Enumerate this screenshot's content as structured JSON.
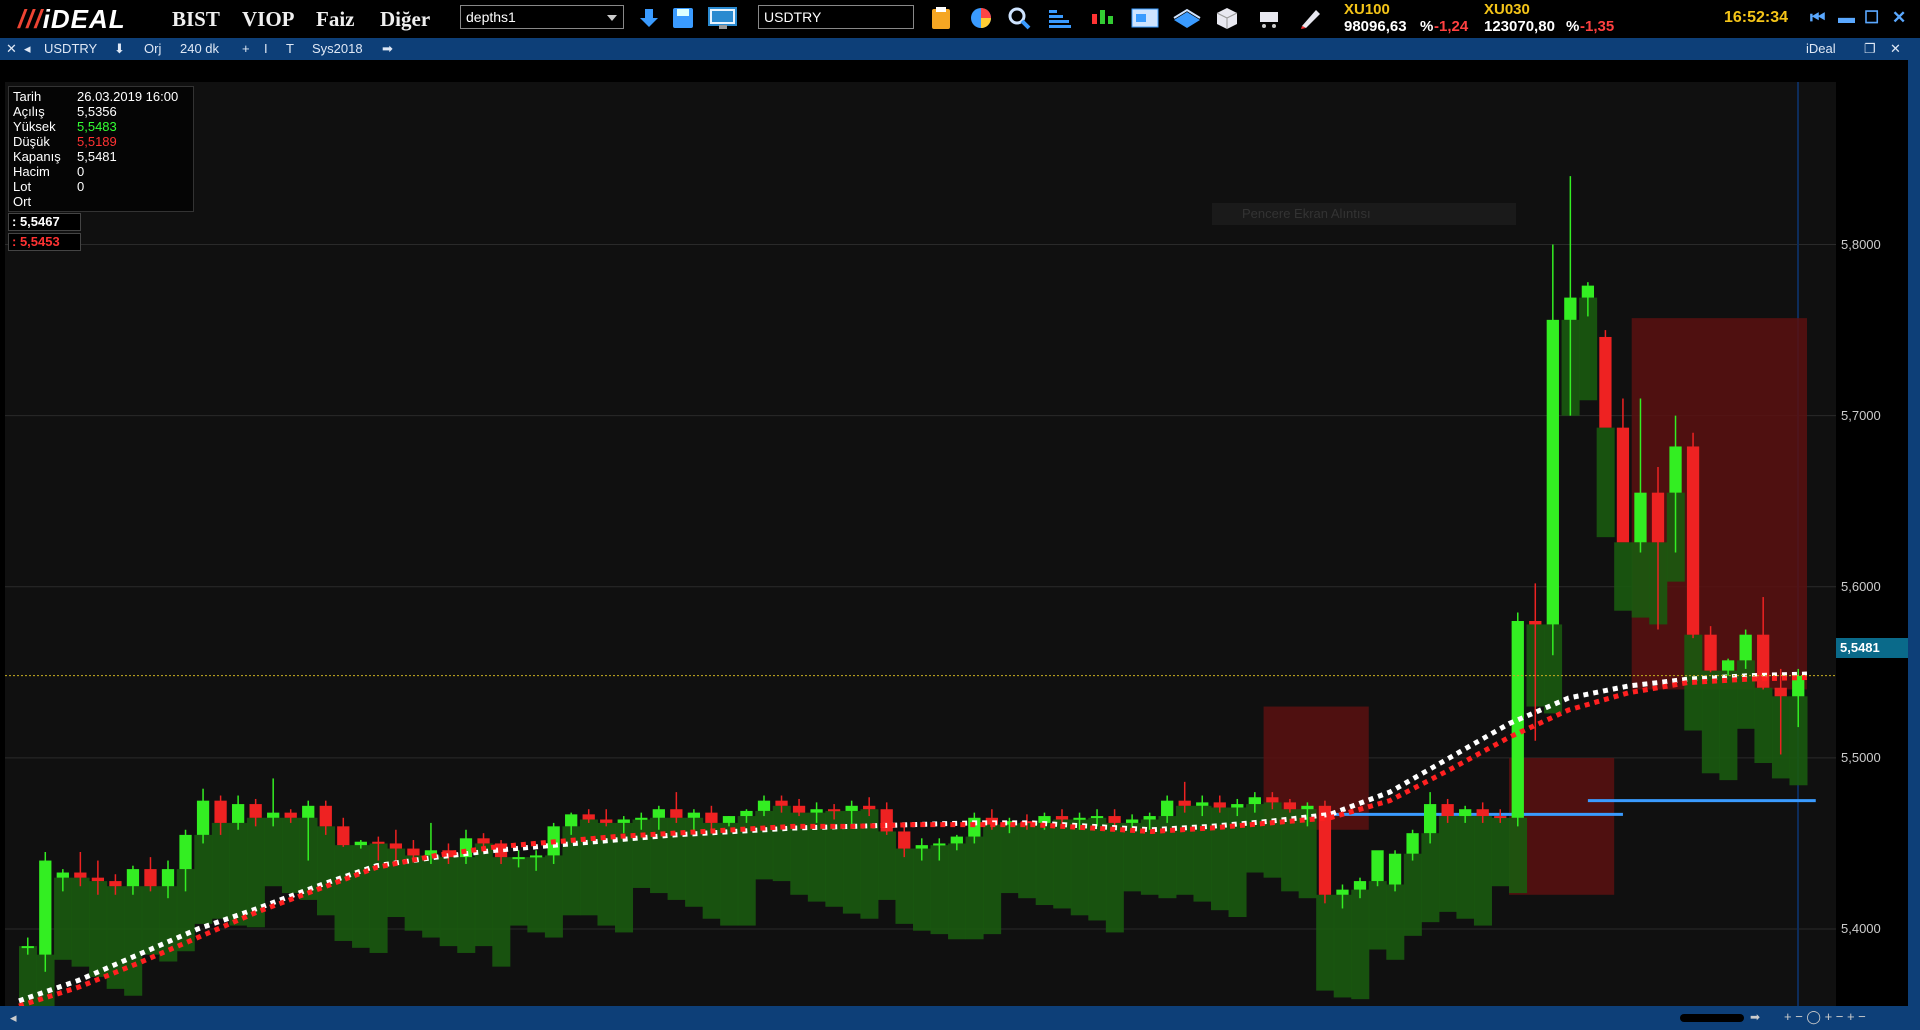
{
  "app": {
    "logo": "iDEAL",
    "menus": [
      "BIST",
      "VIOP",
      "Faiz",
      "Diğer"
    ]
  },
  "toolbar": {
    "layout_select": "depths1",
    "symbol_input": "USDTRY"
  },
  "indices": [
    {
      "name": "XU100",
      "value": "98096,63",
      "pct_label": "%",
      "change": "-1,24"
    },
    {
      "name": "XU030",
      "value": "123070,80",
      "pct_label": "%",
      "change": "-1,35"
    }
  ],
  "clock": "16:52:34",
  "chart_toolbar": {
    "symbol": "USDTRY",
    "orj": "Orj",
    "period": "240 dk",
    "system": "Sys2018",
    "brand": "iDeal"
  },
  "info_panel": {
    "rows": [
      {
        "label": "Tarih",
        "value": "26.03.2019 16:00",
        "color": "#ffffff"
      },
      {
        "label": "Açılış",
        "value": "5,5356",
        "color": "#ffffff"
      },
      {
        "label": "Yüksek",
        "value": "5,5483",
        "color": "#33ff33"
      },
      {
        "label": "Düşük",
        "value": "5,5189",
        "color": "#ff3333"
      },
      {
        "label": "Kapanış",
        "value": "5,5481",
        "color": "#ffffff"
      },
      {
        "label": "Hacim",
        "value": "0",
        "color": "#ffffff"
      },
      {
        "label": "Lot",
        "value": "0",
        "color": "#ffffff"
      },
      {
        "label": "Ort",
        "value": "",
        "color": "#ffffff"
      }
    ],
    "price_white": ": 5,5467",
    "price_red": ": 5,5453"
  },
  "ghost_tooltip": "Pencere Ekran Alıntısı",
  "colors": {
    "up": "#33ee22",
    "down": "#ee2222",
    "shadow_green": "#1a5a10",
    "shadow_red": "#5a1010",
    "accent": "#0d3f78"
  },
  "chart_data": {
    "type": "candlestick",
    "ylim": [
      5.355,
      5.895
    ],
    "ticks": [
      "5,8000",
      "5,7000",
      "5,6000",
      "5,5000",
      "5,4000"
    ],
    "tick_values": [
      5.8,
      5.7,
      5.6,
      5.5,
      5.4
    ],
    "last_price": "5,5481",
    "last_value": 5.5481,
    "candles": [
      [
        5.39,
        5.395,
        5.385,
        5.39
      ],
      [
        5.385,
        5.445,
        5.375,
        5.44
      ],
      [
        5.43,
        5.435,
        5.422,
        5.433
      ],
      [
        5.433,
        5.445,
        5.425,
        5.43
      ],
      [
        5.43,
        5.44,
        5.42,
        5.428
      ],
      [
        5.428,
        5.432,
        5.42,
        5.425
      ],
      [
        5.425,
        5.437,
        5.42,
        5.435
      ],
      [
        5.435,
        5.442,
        5.422,
        5.425
      ],
      [
        5.425,
        5.44,
        5.418,
        5.435
      ],
      [
        5.435,
        5.458,
        5.422,
        5.455
      ],
      [
        5.455,
        5.482,
        5.45,
        5.475
      ],
      [
        5.475,
        5.478,
        5.455,
        5.462
      ],
      [
        5.462,
        5.478,
        5.458,
        5.473
      ],
      [
        5.473,
        5.476,
        5.46,
        5.465
      ],
      [
        5.465,
        5.488,
        5.46,
        5.468
      ],
      [
        5.468,
        5.47,
        5.462,
        5.465
      ],
      [
        5.465,
        5.475,
        5.44,
        5.472
      ],
      [
        5.472,
        5.475,
        5.455,
        5.46
      ],
      [
        5.46,
        5.465,
        5.448,
        5.449
      ],
      [
        5.449,
        5.452,
        5.447,
        5.451
      ],
      [
        5.451,
        5.454,
        5.44,
        5.45
      ],
      [
        5.45,
        5.458,
        5.44,
        5.447
      ],
      [
        5.447,
        5.452,
        5.44,
        5.443
      ],
      [
        5.443,
        5.462,
        5.438,
        5.446
      ],
      [
        5.446,
        5.45,
        5.438,
        5.442
      ],
      [
        5.442,
        5.458,
        5.438,
        5.453
      ],
      [
        5.453,
        5.456,
        5.445,
        5.45
      ],
      [
        5.45,
        5.452,
        5.438,
        5.442
      ],
      [
        5.442,
        5.446,
        5.436,
        5.442
      ],
      [
        5.442,
        5.446,
        5.434,
        5.443
      ],
      [
        5.443,
        5.462,
        5.438,
        5.46
      ],
      [
        5.46,
        5.468,
        5.455,
        5.467
      ],
      [
        5.467,
        5.47,
        5.462,
        5.464
      ],
      [
        5.464,
        5.47,
        5.46,
        5.462
      ],
      [
        5.462,
        5.466,
        5.456,
        5.464
      ],
      [
        5.464,
        5.468,
        5.458,
        5.465
      ],
      [
        5.465,
        5.472,
        5.458,
        5.47
      ],
      [
        5.47,
        5.48,
        5.462,
        5.465
      ],
      [
        5.465,
        5.47,
        5.455,
        5.468
      ],
      [
        5.468,
        5.472,
        5.458,
        5.462
      ],
      [
        5.462,
        5.466,
        5.46,
        5.466
      ],
      [
        5.466,
        5.47,
        5.462,
        5.469
      ],
      [
        5.469,
        5.478,
        5.466,
        5.475
      ],
      [
        5.475,
        5.478,
        5.468,
        5.472
      ],
      [
        5.472,
        5.476,
        5.466,
        5.468
      ],
      [
        5.468,
        5.474,
        5.462,
        5.47
      ],
      [
        5.47,
        5.473,
        5.464,
        5.469
      ],
      [
        5.469,
        5.475,
        5.46,
        5.472
      ],
      [
        5.472,
        5.477,
        5.466,
        5.47
      ],
      [
        5.47,
        5.474,
        5.455,
        5.457
      ],
      [
        5.457,
        5.46,
        5.442,
        5.447
      ],
      [
        5.447,
        5.453,
        5.44,
        5.449
      ],
      [
        5.449,
        5.453,
        5.44,
        5.45
      ],
      [
        5.45,
        5.455,
        5.446,
        5.454
      ],
      [
        5.454,
        5.468,
        5.45,
        5.465
      ],
      [
        5.465,
        5.47,
        5.458,
        5.461
      ],
      [
        5.461,
        5.465,
        5.456,
        5.463
      ],
      [
        5.463,
        5.467,
        5.458,
        5.462
      ],
      [
        5.462,
        5.468,
        5.458,
        5.466
      ],
      [
        5.466,
        5.47,
        5.46,
        5.464
      ],
      [
        5.464,
        5.468,
        5.458,
        5.465
      ],
      [
        5.465,
        5.47,
        5.46,
        5.466
      ],
      [
        5.466,
        5.47,
        5.46,
        5.462
      ],
      [
        5.462,
        5.467,
        5.457,
        5.464
      ],
      [
        5.464,
        5.468,
        5.458,
        5.466
      ],
      [
        5.466,
        5.478,
        5.462,
        5.475
      ],
      [
        5.475,
        5.486,
        5.468,
        5.472
      ],
      [
        5.472,
        5.478,
        5.466,
        5.474
      ],
      [
        5.474,
        5.478,
        5.468,
        5.471
      ],
      [
        5.471,
        5.476,
        5.466,
        5.473
      ],
      [
        5.473,
        5.48,
        5.468,
        5.477
      ],
      [
        5.477,
        5.48,
        5.47,
        5.474
      ],
      [
        5.474,
        5.476,
        5.468,
        5.47
      ],
      [
        5.47,
        5.474,
        5.46,
        5.472
      ],
      [
        5.472,
        5.475,
        5.415,
        5.42
      ],
      [
        5.42,
        5.426,
        5.412,
        5.423
      ],
      [
        5.423,
        5.43,
        5.418,
        5.428
      ],
      [
        5.428,
        5.443,
        5.425,
        5.446
      ],
      [
        5.426,
        5.446,
        5.422,
        5.444
      ],
      [
        5.444,
        5.458,
        5.44,
        5.456
      ],
      [
        5.456,
        5.48,
        5.45,
        5.473
      ],
      [
        5.473,
        5.476,
        5.462,
        5.466
      ],
      [
        5.466,
        5.472,
        5.462,
        5.47
      ],
      [
        5.47,
        5.474,
        5.462,
        5.466
      ],
      [
        5.466,
        5.47,
        5.462,
        5.465
      ],
      [
        5.465,
        5.585,
        5.46,
        5.58
      ],
      [
        5.58,
        5.602,
        5.51,
        5.578
      ],
      [
        5.578,
        5.8,
        5.56,
        5.756
      ],
      [
        5.756,
        5.84,
        5.7,
        5.769
      ],
      [
        5.769,
        5.778,
        5.758,
        5.776
      ],
      [
        5.746,
        5.75,
        5.7,
        5.693
      ],
      [
        5.693,
        5.71,
        5.63,
        5.626
      ],
      [
        5.626,
        5.71,
        5.62,
        5.655
      ],
      [
        5.655,
        5.67,
        5.575,
        5.626
      ],
      [
        5.655,
        5.7,
        5.62,
        5.682
      ],
      [
        5.682,
        5.69,
        5.57,
        5.572
      ],
      [
        5.572,
        5.577,
        5.55,
        5.551
      ],
      [
        5.551,
        5.558,
        5.548,
        5.557
      ],
      [
        5.557,
        5.575,
        5.552,
        5.572
      ],
      [
        5.572,
        5.594,
        5.54,
        5.541
      ],
      [
        5.541,
        5.552,
        5.502,
        5.536
      ],
      [
        5.536,
        5.552,
        5.518,
        5.548
      ]
    ],
    "ma_white": [
      5.358,
      5.37,
      5.385,
      5.4,
      5.412,
      5.425,
      5.437,
      5.442,
      5.446,
      5.449,
      5.452,
      5.455,
      5.457,
      5.459,
      5.46,
      5.461,
      5.462,
      5.462,
      5.46,
      5.458,
      5.46,
      5.463,
      5.467,
      5.48,
      5.5,
      5.52,
      5.535,
      5.542,
      5.546,
      5.548,
      5.549
    ],
    "ma_red": [
      5.355,
      5.366,
      5.38,
      5.395,
      5.41,
      5.423,
      5.436,
      5.443,
      5.448,
      5.451,
      5.454,
      5.456,
      5.458,
      5.46,
      5.46,
      5.461,
      5.461,
      5.461,
      5.459,
      5.457,
      5.459,
      5.462,
      5.465,
      5.475,
      5.493,
      5.512,
      5.528,
      5.538,
      5.544,
      5.546,
      5.547
    ],
    "red_zones": [
      [
        5.53,
        5.458,
        5.526,
        5.455
      ],
      [
        5.5,
        5.42,
        5.5,
        5.42
      ],
      [
        5.757,
        5.54,
        5.757,
        5.54
      ]
    ],
    "blue_levels": [
      5.467,
      5.475
    ]
  }
}
